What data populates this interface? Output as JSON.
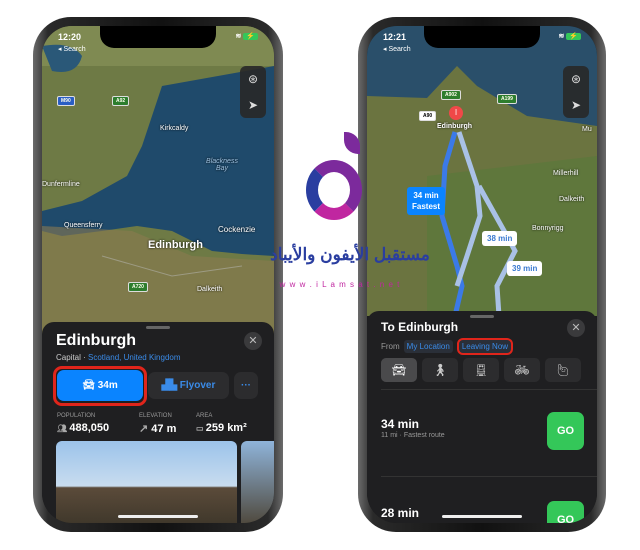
{
  "left_phone": {
    "status": {
      "time": "12:20",
      "back_label": "◂ Search"
    },
    "map": {
      "labels": [
        "Kirkcaldy",
        "Blackness Bay",
        "Queensferry",
        "Edinburgh",
        "Cockenzie",
        "Dalkeith",
        "Dunfermline"
      ],
      "shields": [
        "M90",
        "A92",
        "A720"
      ]
    },
    "place": {
      "title": "Edinburgh",
      "category": "Capital",
      "separator": " · ",
      "location_link": "Scotland, United Kingdom",
      "directions_label": "34m",
      "flyover_label": "Flyover",
      "more_label": "···",
      "stats": [
        {
          "label": "POPULATION",
          "value": "488,050"
        },
        {
          "label": "ELEVATION",
          "value": "47 m"
        },
        {
          "label": "AREA",
          "value": "259 km²"
        }
      ]
    }
  },
  "right_phone": {
    "status": {
      "time": "12:21",
      "back_label": "◂ Search"
    },
    "map": {
      "labels": [
        "Edinburgh",
        "Millerhill",
        "Dalkeith",
        "Bonnyrigg",
        "Mu"
      ],
      "shields": [
        "A902",
        "A199",
        "A90"
      ],
      "route_tags": [
        {
          "time": "34 min",
          "note": "Fastest"
        },
        {
          "time": "38 min"
        },
        {
          "time": "39 min"
        }
      ]
    },
    "directions": {
      "title": "To Edinburgh",
      "from_label": "From",
      "from_value": "My Location",
      "when_value": "Leaving Now",
      "modes": [
        "car",
        "walk",
        "transit",
        "cycle",
        "ride-share"
      ],
      "routes": [
        {
          "time": "34 min",
          "detail": "11 mi · Fastest route",
          "go_label": "GO"
        },
        {
          "time": "28 min",
          "go_label": "GO"
        }
      ]
    }
  },
  "watermark": {
    "arabic_text": "مستقبل الأيفون والأيباد",
    "url_text": "w w w . i L a m s a t . n e t"
  },
  "colors": {
    "accent_blue": "#0a84ff",
    "go_green": "#34c759",
    "highlight_red": "#e0251b",
    "route_blue": "#3b7ae8",
    "alt_route": "#a9c1e6"
  }
}
